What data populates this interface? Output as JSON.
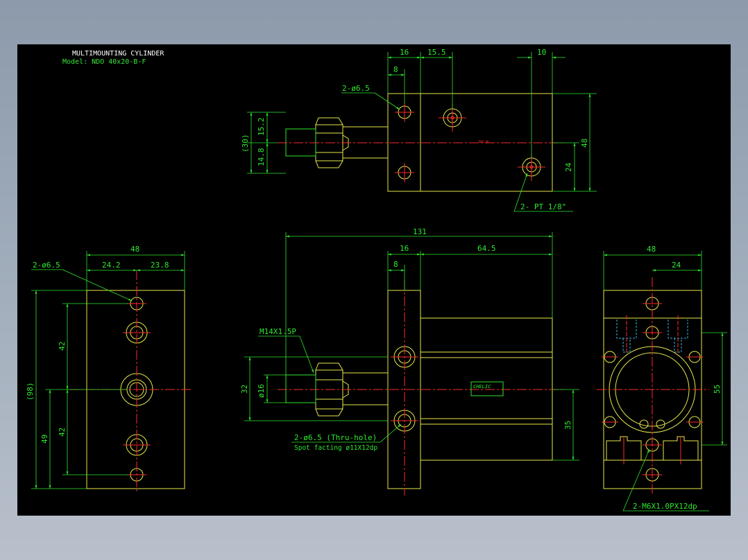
{
  "title": {
    "main": "MULTIMOUNTING CYLINDER",
    "model": "Model: NDO 40x20-B-F"
  },
  "colors": {
    "background": "#000000",
    "outline": "#e8e84a",
    "dimension": "#2ee82e",
    "centerline": "#ff2a2a",
    "hidden": "#34b8e8",
    "title_main": "#ffffff",
    "title_model": "#3be83b"
  },
  "top_view": {
    "dims": {
      "d16": "16",
      "d15_5": "15.5",
      "d10": "10",
      "d8": "8",
      "d15_2": "15.2",
      "d14_8": "14.8",
      "d30": "(30)",
      "d48": "48",
      "d24": "24"
    },
    "callouts": {
      "holes": "2-ø6.5",
      "port": "2- PT 1/8\""
    },
    "plate": "NDO 40"
  },
  "left_view": {
    "dims": {
      "d48": "48",
      "d24_2": "24.2",
      "d23_8": "23.8",
      "d42a": "42",
      "d42b": "42",
      "d49": "49",
      "d98": "(98)"
    },
    "callouts": {
      "holes": "2-ø6.5"
    }
  },
  "front_view": {
    "dims": {
      "d131": "131",
      "d16": "16",
      "d64_5": "64.5",
      "d8": "8",
      "d32": "32",
      "d16dia": "ø16",
      "d35": "35"
    },
    "callouts": {
      "thread": "M14X1.5P",
      "holes": "2-ø6.5 (Thru-hole)",
      "spot": "Spot facting  ø11X12dp"
    },
    "label": "CHELIC"
  },
  "right_view": {
    "dims": {
      "d48": "48",
      "d24": "24",
      "d55": "55"
    },
    "callouts": {
      "thread": "2-M6X1.0PX12dp"
    }
  }
}
